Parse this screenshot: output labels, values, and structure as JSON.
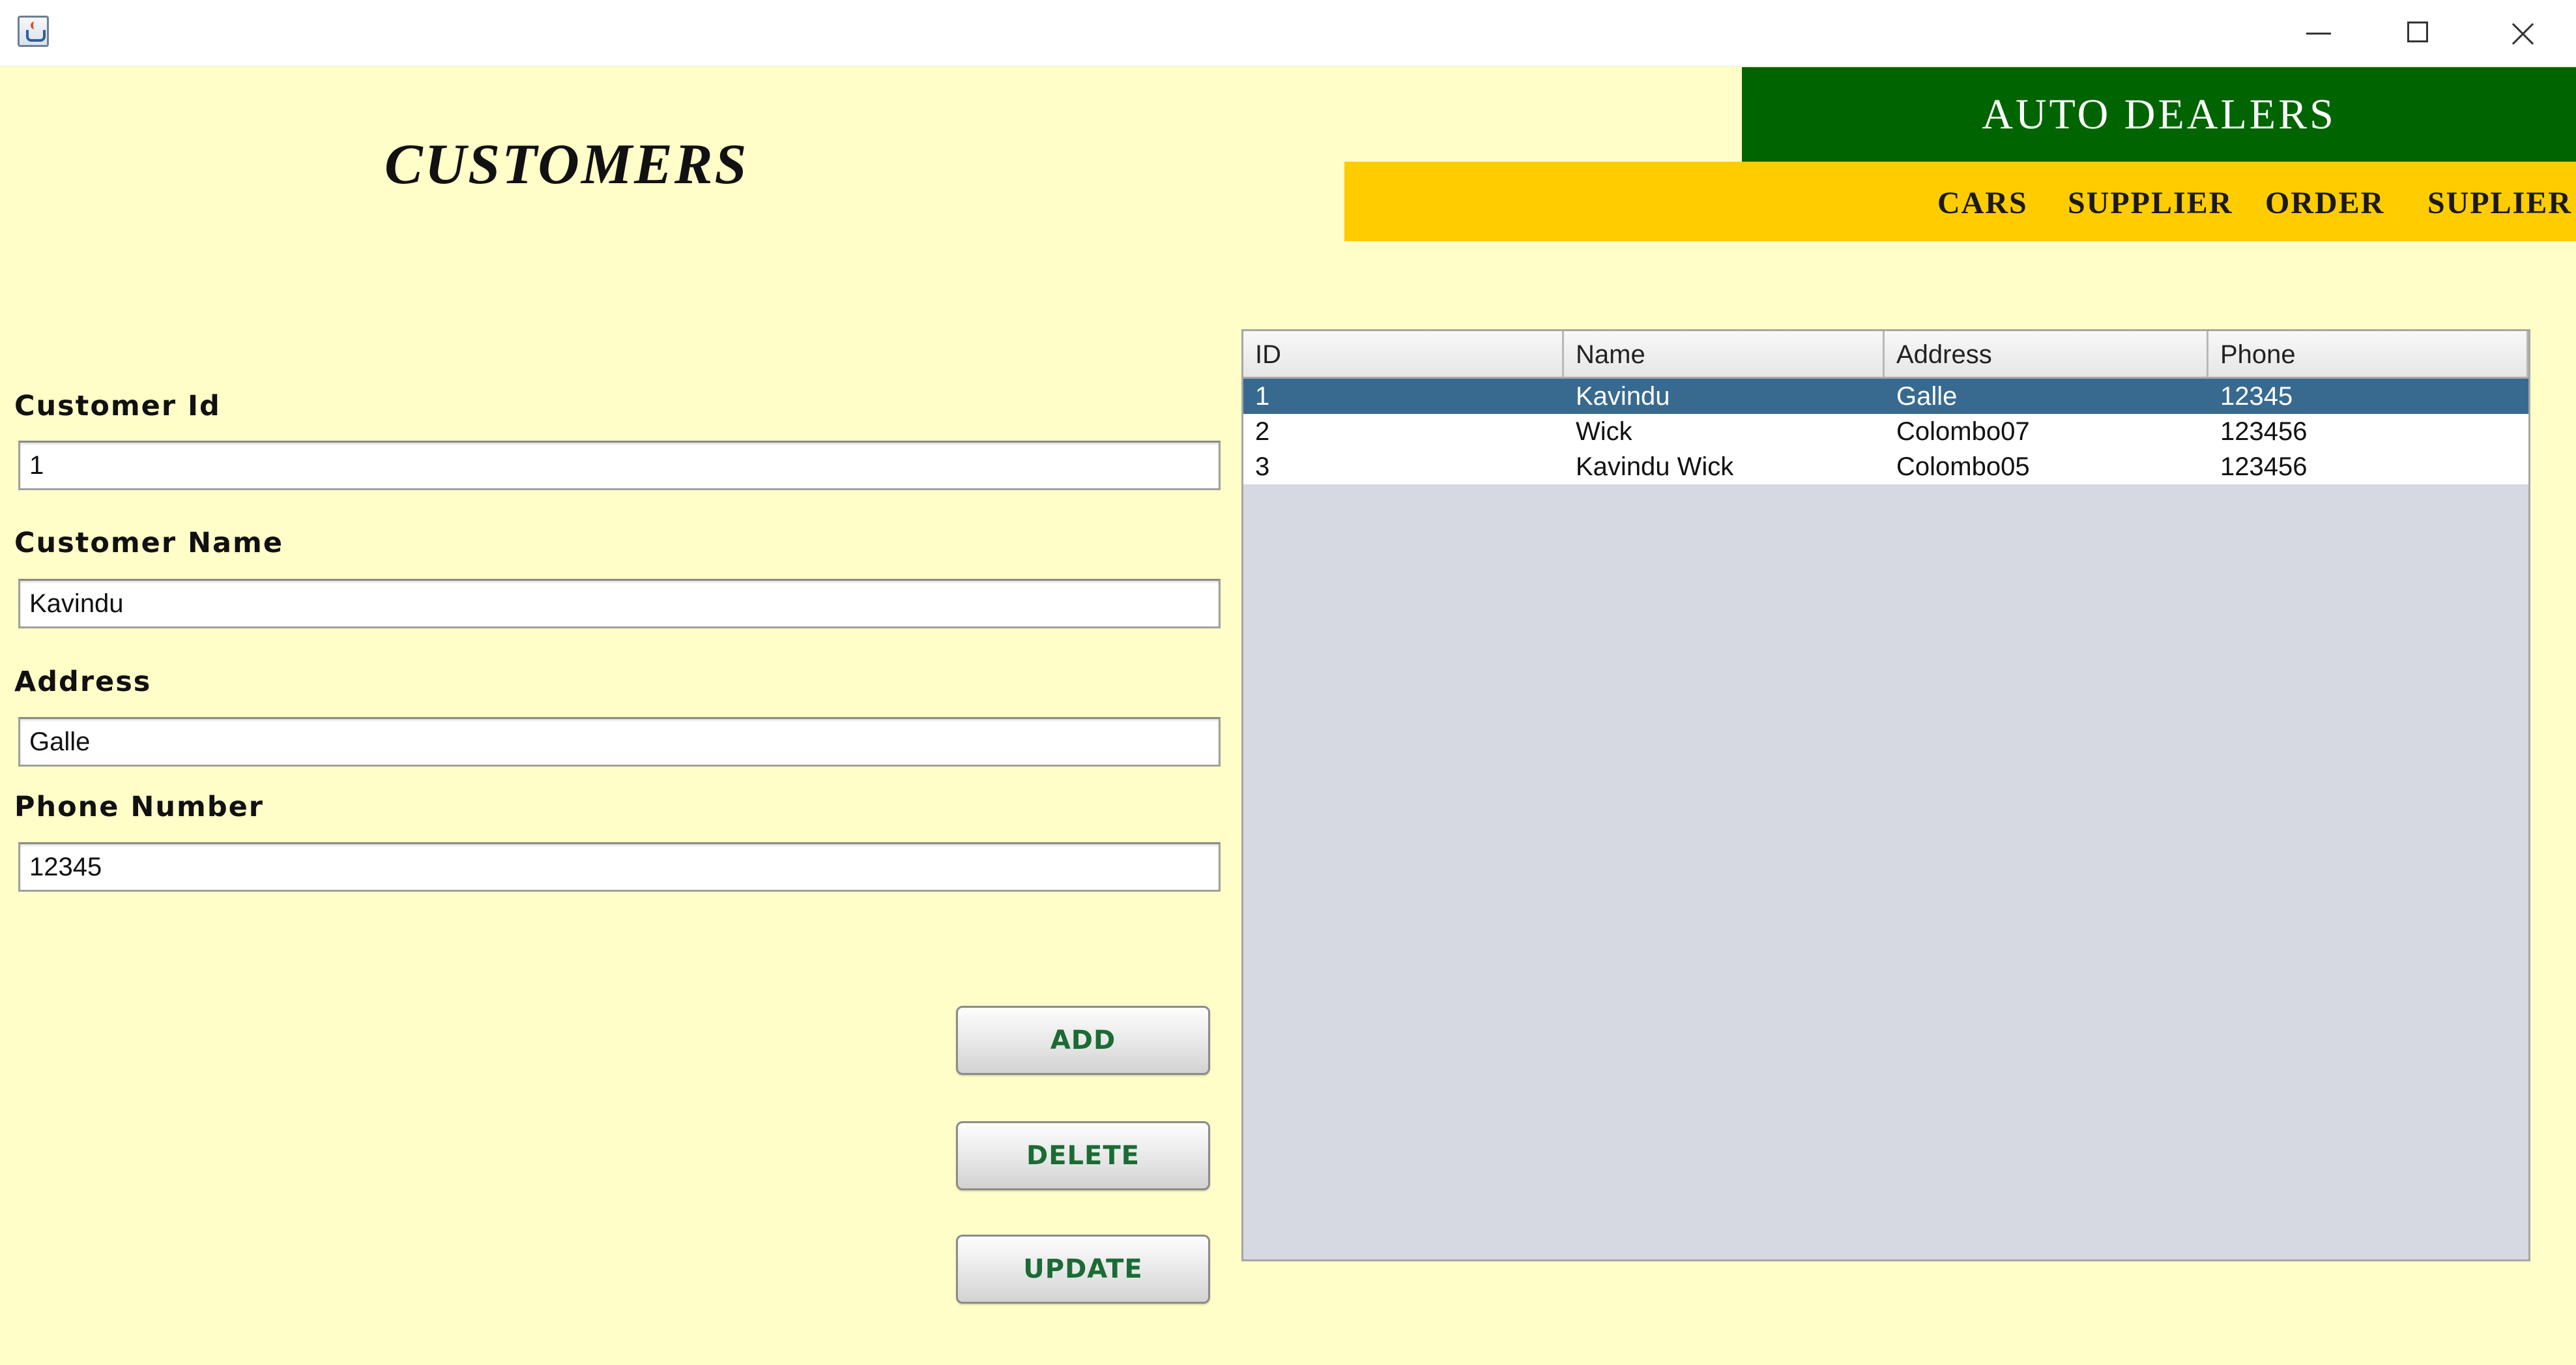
{
  "window": {
    "icons": {
      "app": "java-app-icon",
      "minimize": "minimize-icon",
      "maximize": "maximize-icon",
      "close": "close-icon"
    }
  },
  "header": {
    "title": "CUSTOMERS",
    "brand": "AUTO DEALERS",
    "nav": [
      "CARS",
      "SUPPLIER",
      "ORDER",
      "SUPLIER"
    ]
  },
  "form": {
    "fields": [
      {
        "label": "Customer Id",
        "value": "1"
      },
      {
        "label": "Customer Name",
        "value": "Kavindu"
      },
      {
        "label": "Address",
        "value": "Galle"
      },
      {
        "label": "Phone Number",
        "value": "12345"
      }
    ],
    "buttons": {
      "add": "ADD",
      "delete": "DELETE",
      "update": "UPDATE"
    }
  },
  "table": {
    "columns": [
      "ID",
      "Name",
      "Address",
      "Phone"
    ],
    "rows": [
      [
        "1",
        "Kavindu",
        "Galle",
        "12345"
      ],
      [
        "2",
        "Wick",
        "Colombo07",
        "123456"
      ],
      [
        "3",
        "Kavindu Wick",
        "Colombo05",
        "123456"
      ]
    ],
    "selected_row": 0
  },
  "colors": {
    "background": "#fffdc8",
    "brand_bar": "#006400",
    "nav_bar": "#ffcc00",
    "button_text": "#1b6b35",
    "selected_row": "#386a8f",
    "table_empty_area": "#d6d9e0"
  }
}
